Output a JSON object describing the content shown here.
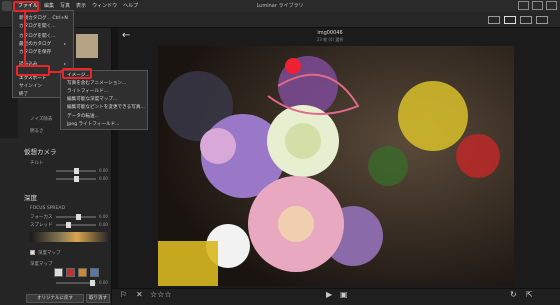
{
  "menubar": {
    "items": [
      "ファイル",
      "編集",
      "写真",
      "表示",
      "ウィンドウ",
      "ヘルプ"
    ],
    "title": "Luminar ライブラリ"
  },
  "file_menu": {
    "items": [
      {
        "label": "新規カタログ...   Ctrl+N",
        "submenu": false
      },
      {
        "label": "カタログを開く...",
        "submenu": false
      },
      {
        "label": "カタログを開く...",
        "submenu": false
      },
      {
        "label": "最近のカタログ",
        "submenu": true
      },
      {
        "label": "カタログを保存",
        "submenu": false
      },
      {
        "label": "読み込み",
        "submenu": true
      },
      {
        "label": "エクスポート",
        "submenu": true
      },
      {
        "label": "サインイン",
        "submenu": false
      },
      {
        "label": "終了",
        "submenu": false
      }
    ]
  },
  "export_submenu": {
    "items": [
      "イメージ...",
      "写真を含むアニメーション...",
      "ライトフィールド...",
      "編集可能な深度マップ...",
      "編集可能なピントを変更できる写真...",
      "データの転送...",
      "Jpeg ライトフィールド..."
    ]
  },
  "left_panel": {
    "sections": {
      "camera": "仮想カメラ",
      "tilt": "チルト",
      "depth": "深度",
      "focus_spread": "FOCUS SPREAD",
      "focus_label": "フォーカス",
      "spread_label": "スプレッド",
      "depth_map": "深度マップ",
      "noise_label": "ノイズ除去",
      "brightness_label": "明るさ"
    },
    "values": [
      "0.00",
      "0.00",
      "0.00",
      "0.00",
      "0.00"
    ],
    "checkbox_label": "深度マップ",
    "buttons": {
      "revert": "オリジナルに戻す",
      "undo": "取り消す"
    }
  },
  "photo": {
    "title": "img00046",
    "subtitle": "23 枚 (4) 選択"
  },
  "colors": {
    "highlight": "#e8262a",
    "background": "#1e1e1e"
  }
}
